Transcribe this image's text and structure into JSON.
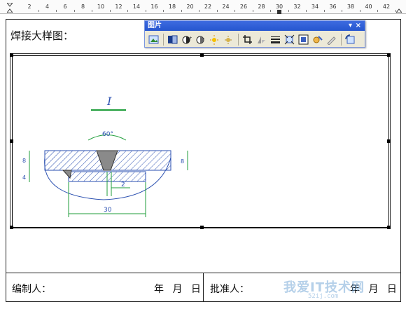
{
  "ruler": {
    "marks": [
      "2",
      "4",
      "6",
      "8",
      "10",
      "12",
      "14",
      "16",
      "18",
      "20",
      "22",
      "24",
      "26",
      "28",
      "30",
      "32",
      "34",
      "36",
      "38",
      "40",
      "42"
    ]
  },
  "document": {
    "title": "焊接大样图：",
    "footer": {
      "compiler_label": "编制人：",
      "date_label": "年 月 日",
      "approver_label": "批准人：",
      "date_label_right": "年 月 日"
    }
  },
  "drawing": {
    "detail_label": "I",
    "angle_label": "60°",
    "dim_left_top": "8",
    "dim_left_bottom": "4",
    "dim_right": "8",
    "dim_gap": "2",
    "dim_bottom": "30"
  },
  "toolbar": {
    "title": "图片",
    "dropdown_glyph": "▾",
    "close_glyph": "×",
    "buttons": [
      "insert-picture",
      "color",
      "more-contrast",
      "less-contrast",
      "more-brightness",
      "less-brightness",
      "crop",
      "rotate-left",
      "line-style",
      "compress-pictures",
      "text-wrapping",
      "format-picture",
      "set-transparent-color",
      "reset-picture"
    ]
  },
  "watermark": {
    "text": "我爱IT技术网",
    "subtext": "52ij.com"
  },
  "colors": {
    "drawing_green": "#1f9e3a",
    "drawing_blue": "#2a4fb0",
    "toolbar_title_bar": "#2a5bd3",
    "weld_gray": "#8a8a8a"
  }
}
